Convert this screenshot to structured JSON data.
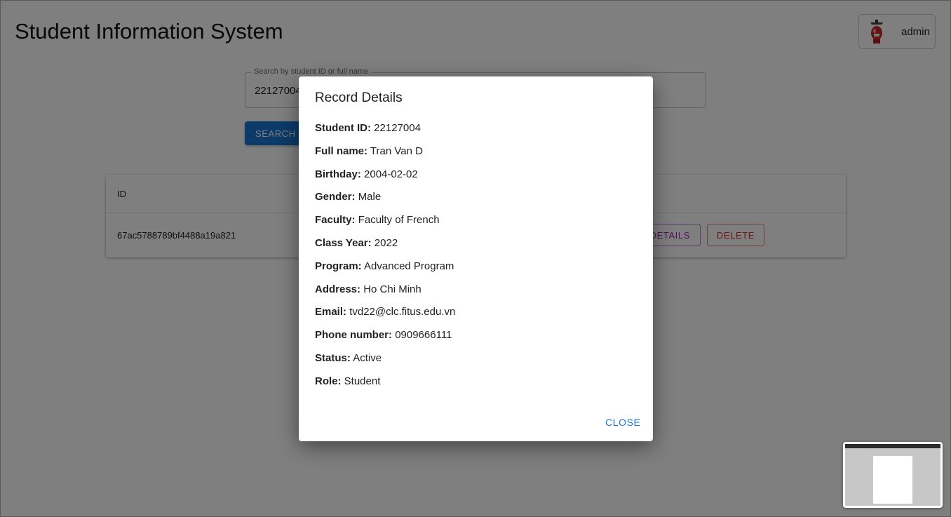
{
  "app": {
    "title": "Student Information System"
  },
  "user": {
    "name": "admin",
    "avatar_icon": "fire-extinguisher-avatar"
  },
  "search": {
    "label": "Search by student ID or full name",
    "value": "22127004",
    "button_label": "SEARCH"
  },
  "table": {
    "columns": [
      "ID"
    ],
    "rows": [
      {
        "id": "67ac5788789bf4488a19a821",
        "details_label": "DETAILS",
        "delete_label": "DELETE"
      }
    ]
  },
  "dialog": {
    "title": "Record Details",
    "fields": [
      {
        "label": "Student ID:",
        "value": "22127004"
      },
      {
        "label": "Full name:",
        "value": "Tran Van D"
      },
      {
        "label": "Birthday:",
        "value": "2004-02-02"
      },
      {
        "label": "Gender:",
        "value": "Male"
      },
      {
        "label": "Faculty:",
        "value": "Faculty of French"
      },
      {
        "label": "Class Year:",
        "value": "2022"
      },
      {
        "label": "Program:",
        "value": "Advanced Program"
      },
      {
        "label": "Address:",
        "value": "Ho Chi Minh"
      },
      {
        "label": "Email:",
        "value": "tvd22@clc.fitus.edu.vn"
      },
      {
        "label": "Phone number:",
        "value": "0909666111"
      },
      {
        "label": "Status:",
        "value": "Active"
      },
      {
        "label": "Role:",
        "value": "Student"
      }
    ],
    "close_label": "CLOSE"
  },
  "colors": {
    "primary": "#1976d2",
    "details": "#9c27b0",
    "delete": "#d32f2f",
    "backdrop": "rgba(0,0,0,0.5)"
  }
}
